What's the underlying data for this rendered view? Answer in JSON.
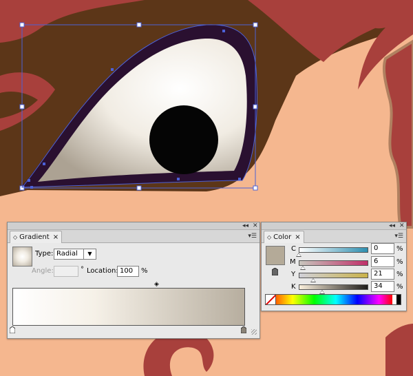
{
  "gradient_panel": {
    "tab_label": "Gradient",
    "close_glyph": "×",
    "type_label": "Type:",
    "type_value": "Radial",
    "angle_label": "Angle:",
    "angle_value": "",
    "degree_symbol": "°",
    "location_label": "Location:",
    "location_value": "100",
    "percent": "%"
  },
  "color_panel": {
    "tab_label": "Color",
    "close_glyph": "×",
    "channels": [
      {
        "label": "C",
        "value": "0",
        "percent": "%"
      },
      {
        "label": "M",
        "value": "6",
        "percent": "%"
      },
      {
        "label": "Y",
        "value": "21",
        "percent": "%"
      },
      {
        "label": "K",
        "value": "34",
        "percent": "%"
      }
    ],
    "fill_color": "#b4aa98"
  },
  "colors": {
    "skin": "#f5b78f",
    "hair_brown": "#5c3618",
    "hair_red": "#a8403c",
    "gradient_start": "#ffffff",
    "gradient_end": "#b7ae9f",
    "selection_blue": "#4c61d6"
  }
}
